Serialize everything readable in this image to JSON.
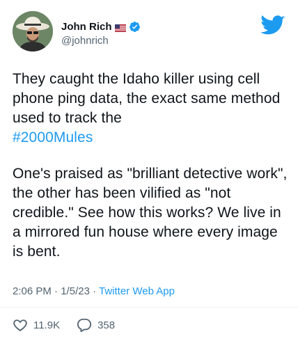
{
  "user": {
    "name": "John Rich",
    "handle": "@johnrich",
    "flag_icon": "us-flag-icon",
    "verified_icon": "verified-badge-icon"
  },
  "tweet": {
    "paragraph1": "They caught the Idaho killer using cell phone ping data, the exact same method used to track the",
    "hashtag": "#2000Mules",
    "paragraph2": "One's praised as \"brilliant detective work\", the other has been vilified as \"not credible.\" See how this works? We live in a mirrored fun house where every image is bent."
  },
  "meta": {
    "time": "2:06 PM",
    "separator": " · ",
    "date": "1/5/23",
    "source": "Twitter Web App"
  },
  "actions": {
    "likes": "11.9K",
    "replies": "358"
  },
  "colors": {
    "accent": "#1d9bf0",
    "text": "#0f1419",
    "secondary": "#536471"
  }
}
